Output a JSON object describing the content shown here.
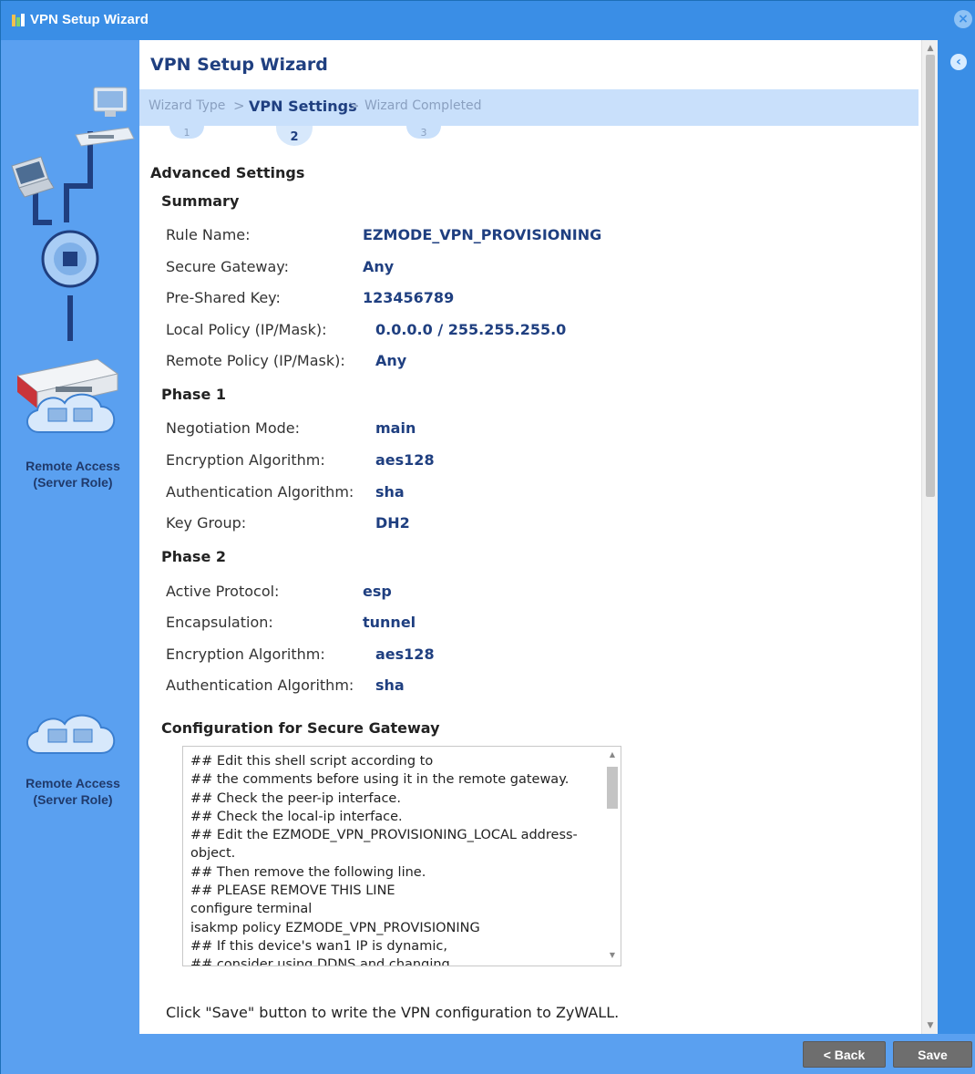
{
  "window": {
    "title": "VPN Setup Wizard"
  },
  "left_panel": {
    "role_label_top": [
      "Remote Access",
      "(Server Role)"
    ],
    "role_label_bottom": [
      "Remote Access",
      "(Server Role)"
    ]
  },
  "wizard": {
    "title": "VPN Setup Wizard",
    "steps": [
      {
        "label": "Wizard Type",
        "number": "1",
        "active": false
      },
      {
        "label": "VPN Settings",
        "number": "2",
        "active": true
      },
      {
        "label": "Wizard Completed",
        "number": "3",
        "active": false
      }
    ],
    "separator": ">"
  },
  "advanced": {
    "heading": "Advanced Settings",
    "summary": {
      "heading": "Summary",
      "rows": [
        {
          "label": "Rule Name:",
          "value": "EZMODE_VPN_PROVISIONING"
        },
        {
          "label": "Secure Gateway:",
          "value": "Any"
        },
        {
          "label": "Pre-Shared Key:",
          "value": "123456789"
        },
        {
          "label": "Local Policy (IP/Mask):",
          "value": "0.0.0.0 / 255.255.255.0"
        },
        {
          "label": "Remote Policy (IP/Mask):",
          "value": "Any"
        }
      ]
    },
    "phase1": {
      "heading": "Phase 1",
      "rows": [
        {
          "label": "Negotiation Mode:",
          "value": "main"
        },
        {
          "label": "Encryption Algorithm:",
          "value": "aes128"
        },
        {
          "label": "Authentication Algorithm:",
          "value": "sha"
        },
        {
          "label": "Key Group:",
          "value": "DH2"
        }
      ]
    },
    "phase2": {
      "heading": "Phase 2",
      "rows": [
        {
          "label": "Active Protocol:",
          "value": "esp"
        },
        {
          "label": "Encapsulation:",
          "value": "tunnel"
        },
        {
          "label": "Encryption Algorithm:",
          "value": "aes128"
        },
        {
          "label": "Authentication Algorithm:",
          "value": "sha"
        }
      ]
    }
  },
  "config": {
    "heading": "Configuration for Secure Gateway",
    "script": "## Edit this shell script according to\n## the comments before using it in the remote gateway.\n## Check the peer-ip interface.\n## Check the local-ip interface.\n## Edit the EZMODE_VPN_PROVISIONING_LOCAL address-object.\n## Then remove the following line.\n## PLEASE REMOVE THIS LINE\nconfigure terminal\nisakmp policy EZMODE_VPN_PROVISIONING\n## If this device's wan1 IP is dynamic,\n## consider using DDNS and changing"
  },
  "save_note": "Click \"Save\" button to write the VPN configuration to ZyWALL.",
  "footer": {
    "back_label": "< Back",
    "save_label": "Save"
  },
  "colors": {
    "title_bar": "#3a8ee6",
    "side_panel": "#5aa0f0",
    "accent_text": "#1f3f80",
    "steps_bg": "#c9e0fb",
    "button": "#6e6e6e"
  },
  "icons": [
    "wizard-app-icon",
    "close-icon",
    "collapse-panel-icon",
    "network-diagram-illustration",
    "cloud-computers-icon"
  ]
}
